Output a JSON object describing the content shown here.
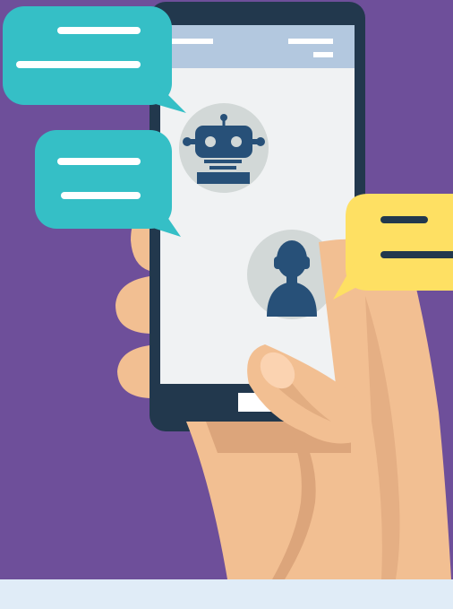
{
  "illustration": {
    "subject": "",
    "colors": {
      "background": "#6e4f9a",
      "floor": "#e0ecf7",
      "phone_body": "#22384d",
      "phone_screen": "#f0f2f3",
      "screen_header": "#b3c8df",
      "skin": "#f2bf92",
      "skin_shadow": "#dca57b",
      "bubble_teal": "#35bfc6",
      "bubble_yellow": "#fee063",
      "avatar_bg": "#d2d8d7",
      "avatar_figure": "#275078"
    },
    "icons": {
      "bot_avatar": "robot-icon",
      "user_avatar": "person-icon",
      "bubbles": "speech-bubble-icon"
    }
  }
}
